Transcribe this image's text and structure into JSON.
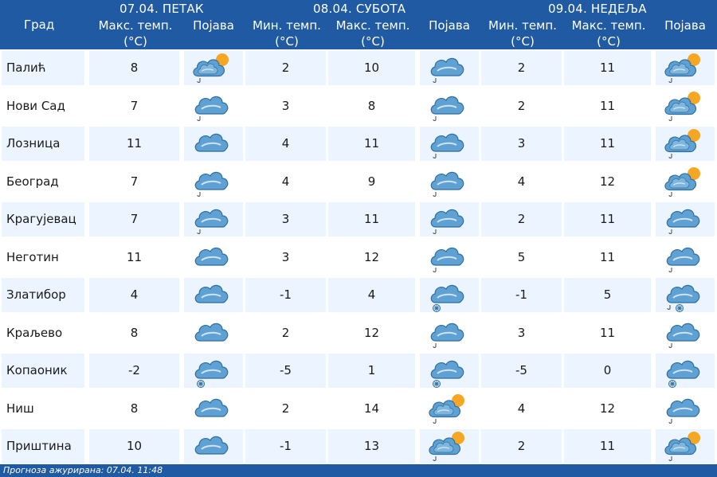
{
  "header": {
    "city_col": "Град",
    "days": [
      {
        "date": "07.04. ПЕТАК"
      },
      {
        "date": "08.04. СУБОТА"
      },
      {
        "date": "09.04. НЕДЕЉА"
      }
    ],
    "max_temp_l1": "Макс. темп.",
    "max_temp_l2": "(°C)",
    "min_temp_l1": "Мин. темп.",
    "min_temp_l2": "(°C)",
    "phenomenon": "Појава"
  },
  "rows": [
    {
      "city": "Палић",
      "d1_max": "8",
      "d1_icon": "partly-cloudy-rain-icon",
      "d2_min": "2",
      "d2_max": "10",
      "d2_icon": "cloud-rain-icon",
      "d3_min": "2",
      "d3_max": "11",
      "d3_icon": "partly-cloudy-rain-icon"
    },
    {
      "city": "Нови Сад",
      "d1_max": "7",
      "d1_icon": "cloud-rain-icon",
      "d2_min": "3",
      "d2_max": "8",
      "d2_icon": "cloud-rain-icon",
      "d3_min": "2",
      "d3_max": "11",
      "d3_icon": "partly-cloudy-rain-icon"
    },
    {
      "city": "Лозница",
      "d1_max": "11",
      "d1_icon": "cloud-icon",
      "d2_min": "4",
      "d2_max": "11",
      "d2_icon": "cloud-rain-icon",
      "d3_min": "3",
      "d3_max": "11",
      "d3_icon": "partly-cloudy-rain-icon"
    },
    {
      "city": "Београд",
      "d1_max": "7",
      "d1_icon": "cloud-rain-icon",
      "d2_min": "4",
      "d2_max": "9",
      "d2_icon": "cloud-rain-icon",
      "d3_min": "4",
      "d3_max": "12",
      "d3_icon": "partly-cloudy-rain-icon"
    },
    {
      "city": "Крагујевац",
      "d1_max": "7",
      "d1_icon": "cloud-rain-icon",
      "d2_min": "3",
      "d2_max": "11",
      "d2_icon": "cloud-rain-icon",
      "d3_min": "2",
      "d3_max": "11",
      "d3_icon": "cloud-rain-icon"
    },
    {
      "city": "Неготин",
      "d1_max": "11",
      "d1_icon": "cloud-icon",
      "d2_min": "3",
      "d2_max": "12",
      "d2_icon": "cloud-rain-icon",
      "d3_min": "5",
      "d3_max": "11",
      "d3_icon": "cloud-rain-icon"
    },
    {
      "city": "Златибор",
      "d1_max": "4",
      "d1_icon": "cloud-icon",
      "d2_min": "-1",
      "d2_max": "4",
      "d2_icon": "cloud-snow-icon",
      "d3_min": "-1",
      "d3_max": "5",
      "d3_icon": "cloud-rain-snow-icon"
    },
    {
      "city": "Краљево",
      "d1_max": "8",
      "d1_icon": "cloud-icon",
      "d2_min": "2",
      "d2_max": "12",
      "d2_icon": "cloud-rain-icon",
      "d3_min": "3",
      "d3_max": "11",
      "d3_icon": "cloud-rain-icon"
    },
    {
      "city": "Копаоник",
      "d1_max": "-2",
      "d1_icon": "cloud-snow-icon",
      "d2_min": "-5",
      "d2_max": "1",
      "d2_icon": "cloud-snow-icon",
      "d3_min": "-5",
      "d3_max": "0",
      "d3_icon": "cloud-snow-icon"
    },
    {
      "city": "Ниш",
      "d1_max": "8",
      "d1_icon": "cloud-icon",
      "d2_min": "2",
      "d2_max": "14",
      "d2_icon": "partly-cloudy-rain-icon",
      "d3_min": "4",
      "d3_max": "12",
      "d3_icon": "cloud-rain-icon"
    },
    {
      "city": "Приштина",
      "d1_max": "10",
      "d1_icon": "cloud-icon",
      "d2_min": "-1",
      "d2_max": "13",
      "d2_icon": "partly-cloudy-rain-icon",
      "d3_min": "2",
      "d3_max": "11",
      "d3_icon": "partly-cloudy-rain-icon"
    }
  ],
  "footer": {
    "text": "Прогноза ажурирана:  07.04.  11:48"
  },
  "colors": {
    "header_bg": "#1f5aa3",
    "row_tint": "#ecf5ff",
    "cloud_fill": "#5fa1d2",
    "sun_fill": "#f5a623"
  }
}
